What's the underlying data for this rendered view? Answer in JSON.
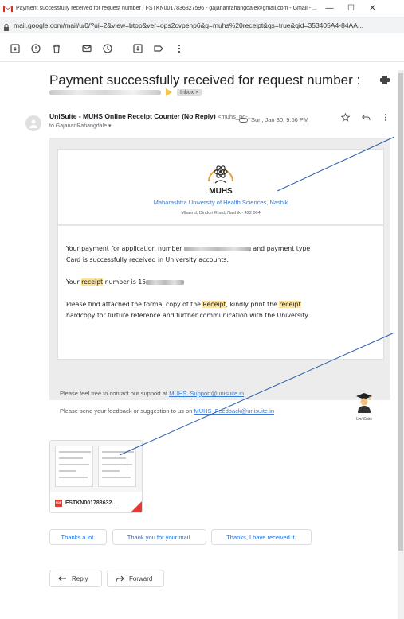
{
  "window": {
    "title": "Payment successfully received for request number : FSTKN0017836327596 - gajananrahangdale@gmail.com - Gmail - ...",
    "min": "—",
    "max": "☐",
    "close": "✕"
  },
  "url": "mail.google.com/mail/u/0/?ui=2&view=btop&ver=ops2cvpehp6&q=muhs%20receipt&qs=true&qid=353405A4-84AA...",
  "toolbar": {
    "icons": [
      "archive-icon",
      "report-spam-icon",
      "delete-icon",
      "mark-unread-icon",
      "snooze-icon",
      "move-to-icon",
      "labels-icon",
      "more-icon"
    ]
  },
  "email": {
    "subject": "Payment successfully received for request number :",
    "inbox_label": "Inbox ×",
    "sender_name": "UniSuite - MUHS Online Receipt Counter (No Reply)",
    "sender_email": "<muhs_no-...",
    "date": "Sun, Jan 30, 9:56 PM",
    "to": "to GajananRahangdale ▾"
  },
  "body": {
    "logo_text": "MUHS",
    "university": "Maharashtra University of Health Sciences, Nashik",
    "address": "Mhasrul, Dindori Road, Nashik - 422 004",
    "p1_a": "Your payment for application number",
    "p1_b": "and payment type",
    "p1_c": "Card is successfully received in University accounts.",
    "p2_a": "Your",
    "p2_hl": "receipt",
    "p2_b": "number is 15",
    "p3_a": "Please find attached the formal copy of the",
    "p3_hl1": "Receipt",
    "p3_b": ", kindly print the",
    "p3_hl2": "receipt",
    "p3_c": "hardcopy for furture reference and further communication with the University."
  },
  "footer": {
    "line1_prefix": "Please feel free to contact our support at",
    "line1_link": "MUHS_Support@unisuite.in",
    "line2_prefix": "Please send your feedback or suggestion to us on",
    "line2_link": "MUHS_Feedback@unisuite.in",
    "brand": "Uni Suite"
  },
  "attachment": {
    "name": "FSTKN001783632...",
    "type": "PDF"
  },
  "smart_replies": [
    "Thanks a lot.",
    "Thank you for your mail.",
    "Thanks, I have received it."
  ],
  "actions": {
    "reply": "Reply",
    "forward": "Forward"
  }
}
